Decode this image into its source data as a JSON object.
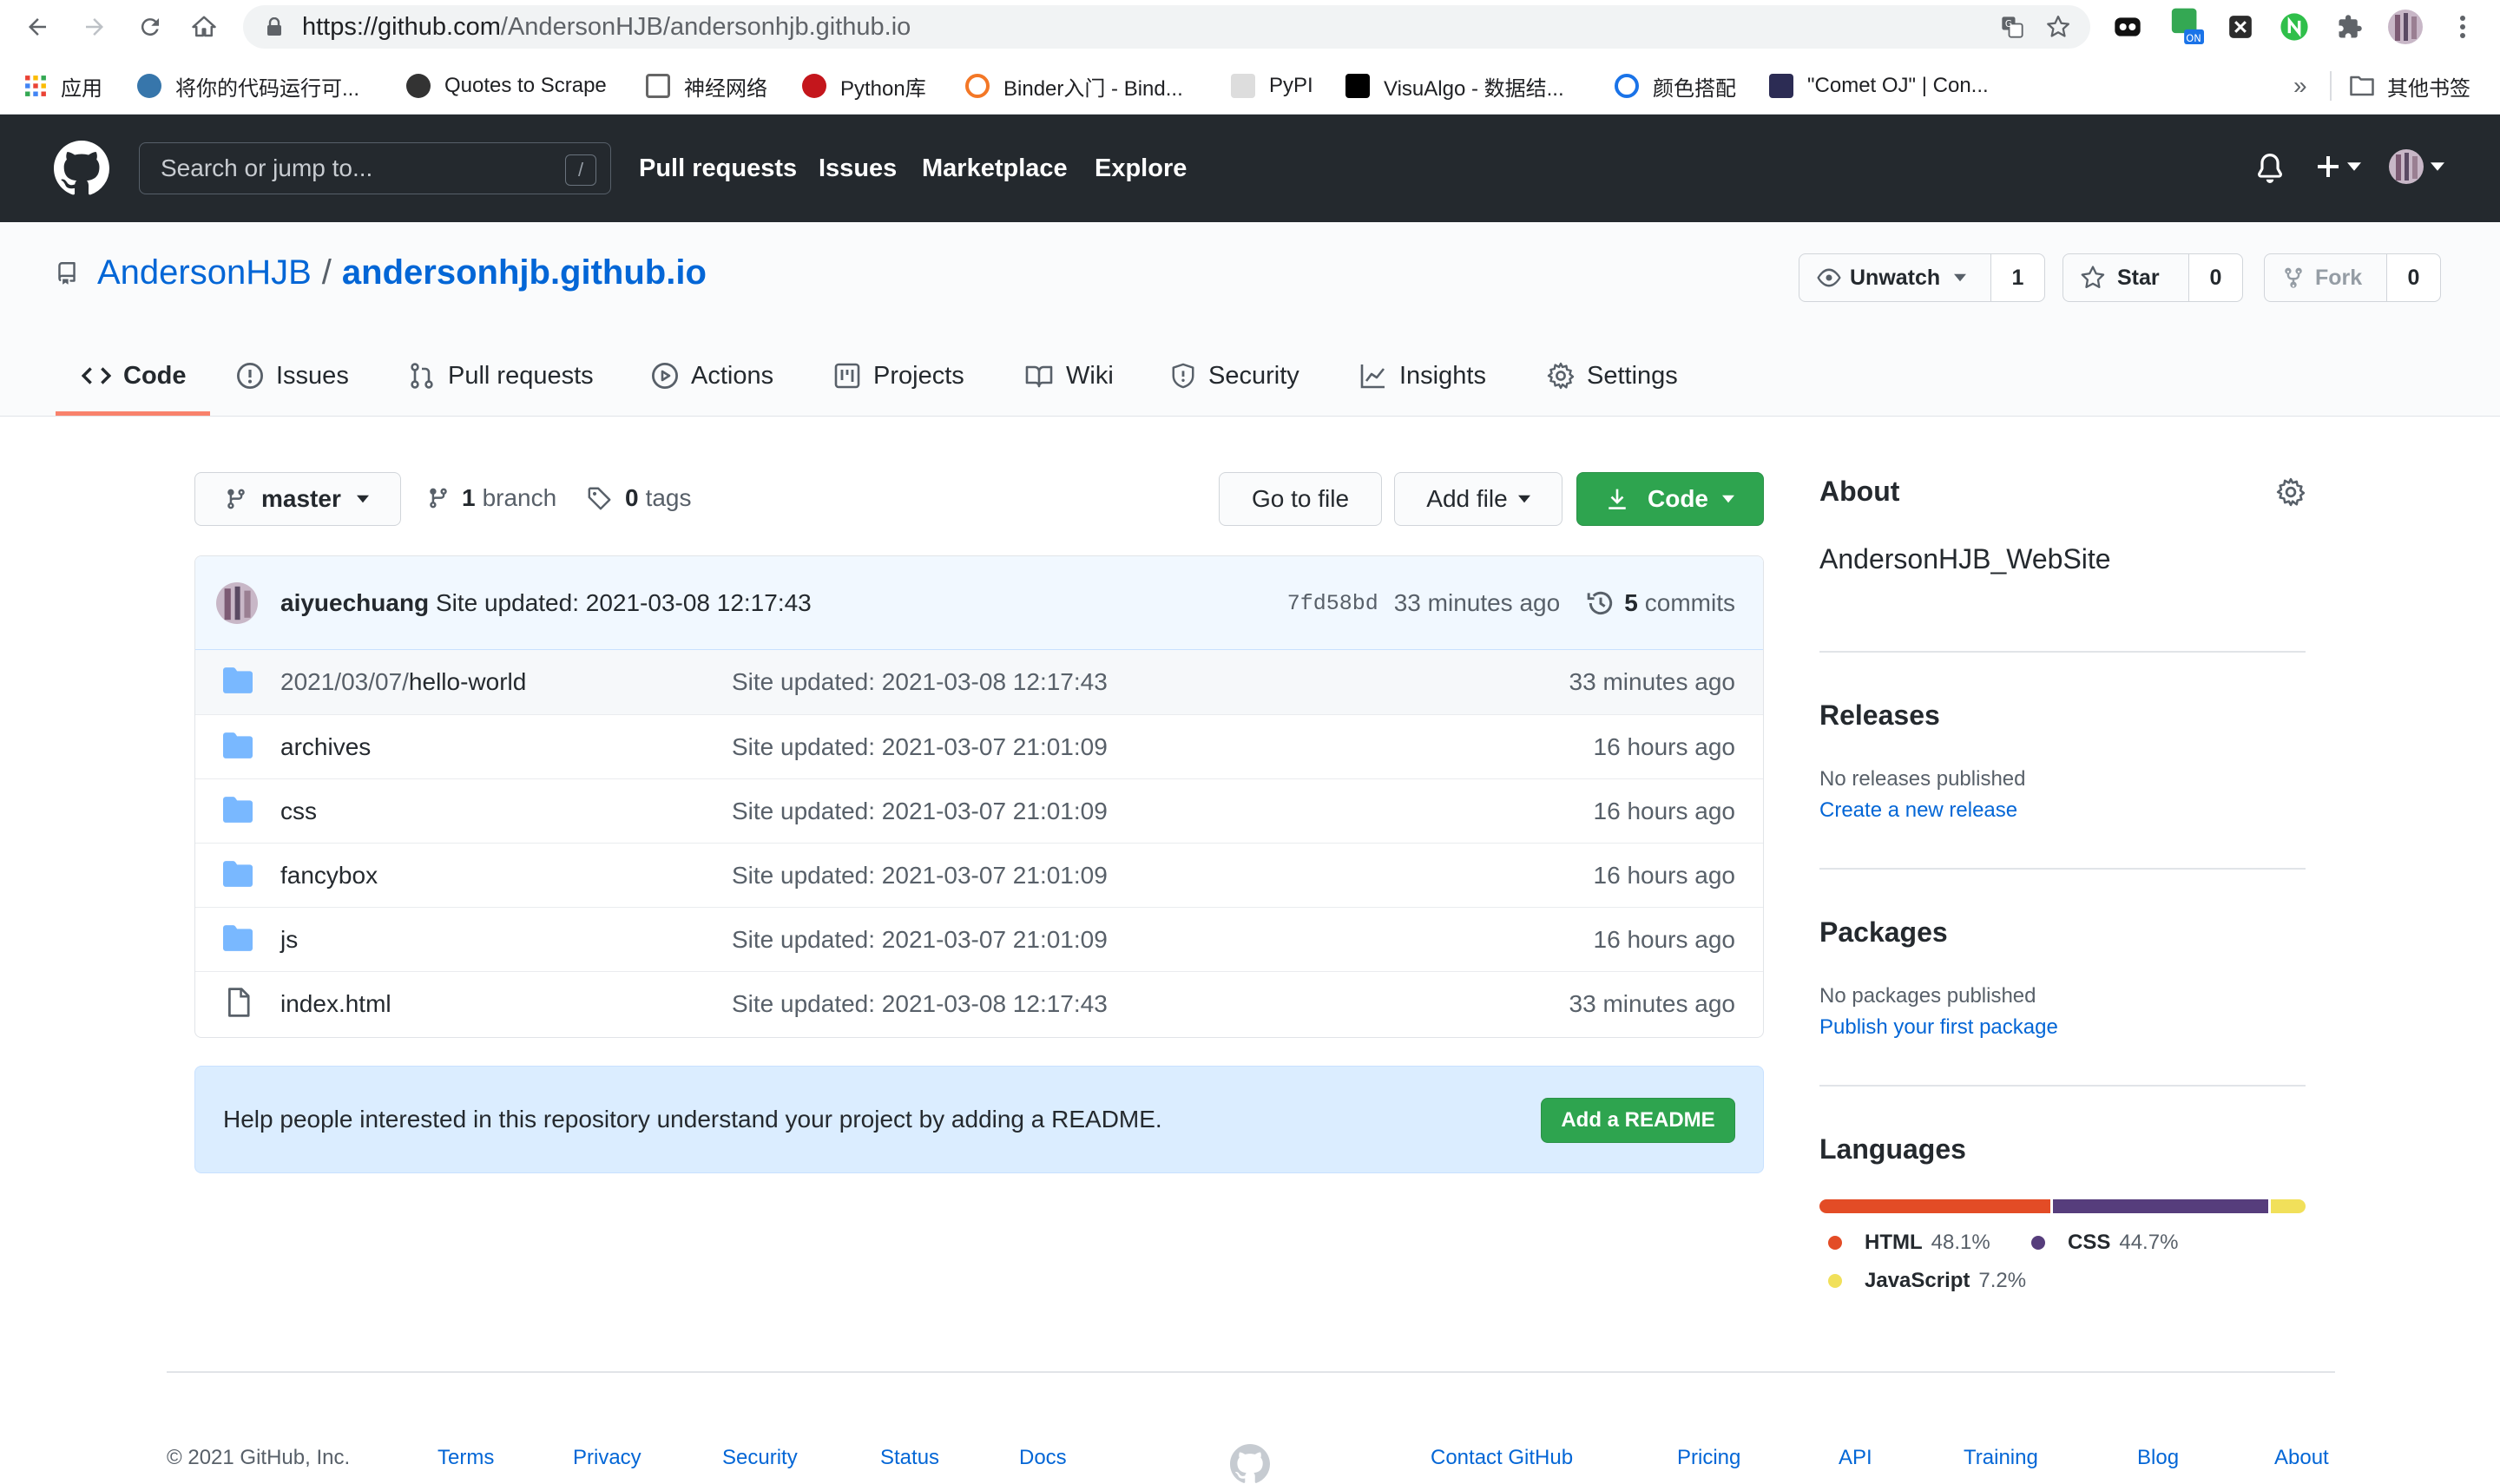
{
  "browser": {
    "url_host": "https://github.com",
    "url_path": "/AndersonHJB/andersonhjb.github.io",
    "bookmarks": [
      {
        "label": "应用",
        "color": "#ea4335"
      },
      {
        "label": "将你的代码运行可...",
        "color": "#3776ab"
      },
      {
        "label": "Quotes to Scrape",
        "color": "#333333"
      },
      {
        "label": "神经网络",
        "color": "#666666"
      },
      {
        "label": "Python库",
        "color": "#c4161c"
      },
      {
        "label": "Binder入门 - Bind...",
        "color": "#f37726"
      },
      {
        "label": "PyPI",
        "color": "#dddddd"
      },
      {
        "label": "VisuAlgo - 数据结...",
        "color": "#000000"
      },
      {
        "label": "颜色搭配",
        "color": "#1a73e8"
      },
      {
        "label": "\"Comet OJ\" | Con...",
        "color": "#2c2c54"
      }
    ],
    "more_bookmarks": "»",
    "other_bookmarks": "其他书签",
    "ext_badge": "ON"
  },
  "gh": {
    "search_placeholder": "Search or jump to...",
    "search_key": "/",
    "nav": [
      "Pull requests",
      "Issues",
      "Marketplace",
      "Explore"
    ]
  },
  "repo": {
    "owner": "AndersonHJB",
    "sep": "/",
    "name": "andersonhjb.github.io",
    "watch_label": "Unwatch",
    "watch_count": "1",
    "star_label": "Star",
    "star_count": "0",
    "fork_label": "Fork",
    "fork_count": "0",
    "tabs": [
      "Code",
      "Issues",
      "Pull requests",
      "Actions",
      "Projects",
      "Wiki",
      "Security",
      "Insights",
      "Settings"
    ]
  },
  "main": {
    "branch": "master",
    "branch_count": "1",
    "branch_word": "branch",
    "tag_count": "0",
    "tag_word": "tags",
    "go_to_file": "Go to file",
    "add_file": "Add file",
    "code_btn": "Code",
    "commit": {
      "author": "aiyuechuang",
      "message": "Site updated: 2021-03-08 12:17:43",
      "sha": "7fd58bd",
      "time": "33 minutes ago",
      "commits_count": "5",
      "commits_word": "commits"
    },
    "files": [
      {
        "prefix": "2021/03/07/",
        "name": "hello-world",
        "type": "folder",
        "msg": "Site updated: 2021-03-08 12:17:43",
        "age": "33 minutes ago"
      },
      {
        "prefix": "",
        "name": "archives",
        "type": "folder",
        "msg": "Site updated: 2021-03-07 21:01:09",
        "age": "16 hours ago"
      },
      {
        "prefix": "",
        "name": "css",
        "type": "folder",
        "msg": "Site updated: 2021-03-07 21:01:09",
        "age": "16 hours ago"
      },
      {
        "prefix": "",
        "name": "fancybox",
        "type": "folder",
        "msg": "Site updated: 2021-03-07 21:01:09",
        "age": "16 hours ago"
      },
      {
        "prefix": "",
        "name": "js",
        "type": "folder",
        "msg": "Site updated: 2021-03-07 21:01:09",
        "age": "16 hours ago"
      },
      {
        "prefix": "",
        "name": "index.html",
        "type": "file",
        "msg": "Site updated: 2021-03-08 12:17:43",
        "age": "33 minutes ago"
      }
    ],
    "readme_text": "Help people interested in this repository understand your project by adding a README.",
    "readme_btn": "Add a README"
  },
  "sidebar": {
    "about_title": "About",
    "about_desc": "AndersonHJB_WebSite",
    "releases_title": "Releases",
    "releases_none": "No releases published",
    "releases_link": "Create a new release",
    "packages_title": "Packages",
    "packages_none": "No packages published",
    "packages_link": "Publish your first package",
    "languages_title": "Languages",
    "languages": [
      {
        "name": "HTML",
        "percent": "48.1%",
        "value": 48.1,
        "color": "#e34c26"
      },
      {
        "name": "CSS",
        "percent": "44.7%",
        "value": 44.7,
        "color": "#563d7c"
      },
      {
        "name": "JavaScript",
        "percent": "7.2%",
        "value": 7.2,
        "color": "#f1e05a"
      }
    ]
  },
  "footer": {
    "copyright": "© 2021 GitHub, Inc.",
    "left_links": [
      "Terms",
      "Privacy",
      "Security",
      "Status",
      "Docs"
    ],
    "right_links": [
      "Contact GitHub",
      "Pricing",
      "API",
      "Training",
      "Blog",
      "About"
    ]
  }
}
